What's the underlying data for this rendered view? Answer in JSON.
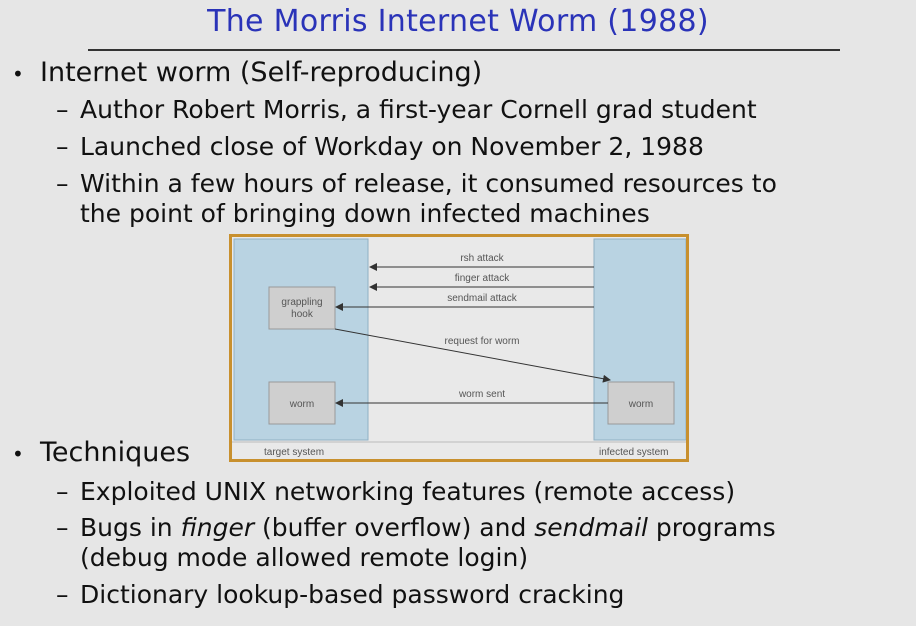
{
  "slide": {
    "title": "The Morris Internet Worm (1988)",
    "bullet1": {
      "text": "Internet worm (Self-reproducing)",
      "subs": [
        "Author Robert Morris, a first-year Cornell grad student",
        "Launched close of Workday on November 2, 1988",
        "Within a few hours of release, it consumed resources to",
        "the point of bringing down infected machines"
      ]
    },
    "bullet2": {
      "text": "Techniques",
      "sub1": "Exploited UNIX networking features (remote access)",
      "sub2_pre": "Bugs in ",
      "sub2_finger": "finger",
      "sub2_mid": " (buffer overflow) and ",
      "sub2_sendmail": "sendmail",
      "sub2_post": " programs",
      "sub2_cont": "(debug mode allowed remote login)",
      "sub3": "Dictionary lookup-based password cracking"
    }
  },
  "diagram": {
    "target_label": "target system",
    "infected_label": "infected system",
    "grappling_line1": "grappling",
    "grappling_line2": "hook",
    "worm_left": "worm",
    "worm_right": "worm",
    "rsh": "rsh attack",
    "finger": "finger attack",
    "sendmail": "sendmail attack",
    "request": "request for worm",
    "sent": "worm sent"
  },
  "colors": {
    "title": "#2a33b8",
    "system_fill": "#b9d3e2",
    "box_fill": "#cfcfcf",
    "frame": "#c8902e"
  }
}
